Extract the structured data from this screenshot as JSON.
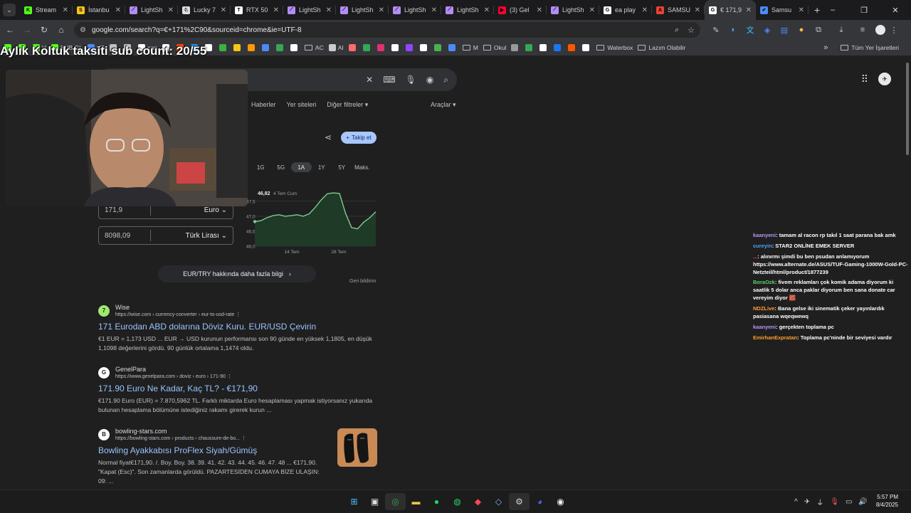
{
  "tabs": [
    {
      "label": "Stream",
      "color": "#53fc18",
      "glyph": "K"
    },
    {
      "label": "İstanbu",
      "color": "#f5c518",
      "glyph": "S"
    },
    {
      "label": "LightSh",
      "color": "#b38cf5",
      "glyph": "⟋"
    },
    {
      "label": "Lucky 7",
      "color": "#dddddd",
      "glyph": "♘"
    },
    {
      "label": "RTX 50",
      "color": "#ffffff",
      "glyph": "T"
    },
    {
      "label": "LightSh",
      "color": "#b38cf5",
      "glyph": "⟋"
    },
    {
      "label": "LightSh",
      "color": "#b38cf5",
      "glyph": "⟋"
    },
    {
      "label": "LightSh",
      "color": "#b38cf5",
      "glyph": "⟋"
    },
    {
      "label": "LightSh",
      "color": "#b38cf5",
      "glyph": "⟋"
    },
    {
      "label": "(3) Gel",
      "color": "#ff0033",
      "glyph": "▶"
    },
    {
      "label": "LightSh",
      "color": "#b38cf5",
      "glyph": "⟋"
    },
    {
      "label": "ea play",
      "color": "#ffffff",
      "glyph": "G"
    },
    {
      "label": "SAMSU",
      "color": "#ea4335",
      "glyph": "A"
    },
    {
      "label": "€ 171,9",
      "color": "#ffffff",
      "glyph": "G",
      "active": true
    },
    {
      "label": "Samsu",
      "color": "#4c8bf5",
      "glyph": "✔"
    }
  ],
  "toolbar": {
    "url": "google.com/search?q=€+171%2C90&sourceid=chrome&ie=UTF-8"
  },
  "bookmarks": [
    {
      "label": "",
      "color": "#53fc18"
    },
    {
      "label": "",
      "color": "#53fc18"
    },
    {
      "label": "V",
      "color": "#53fc18"
    },
    {
      "label": "SUB.GL",
      "color": "#53fc18"
    },
    {
      "label": "VS",
      "color": "#4c8bf5"
    },
    {
      "label": "",
      "color": "#c0c0c0"
    },
    {
      "label": "",
      "color": "#c0c0c0"
    },
    {
      "label": "can",
      "color": "#ffffff"
    },
    {
      "label": "",
      "color": "#ffffff"
    },
    {
      "label": "",
      "color": "#ff4500"
    },
    {
      "label": "",
      "color": "#1d9bf0"
    },
    {
      "label": "",
      "color": "#ffffff"
    },
    {
      "label": "",
      "color": "#3cb043"
    },
    {
      "label": "",
      "color": "#f5c518"
    },
    {
      "label": "",
      "color": "#ff9800"
    },
    {
      "label": "",
      "color": "#4c8bf5"
    },
    {
      "label": "",
      "color": "#34a853"
    },
    {
      "label": "",
      "color": "#ffffff"
    },
    {
      "label": "AC",
      "folder": true
    },
    {
      "label": "AI",
      "color": "#cccccc"
    },
    {
      "label": "",
      "color": "#ff6b6b"
    },
    {
      "label": "",
      "color": "#34a853"
    },
    {
      "label": "",
      "color": "#e1306c"
    },
    {
      "label": "",
      "color": "#ffffff"
    },
    {
      "label": "",
      "color": "#9146ff"
    },
    {
      "label": "",
      "color": "#ffffff"
    },
    {
      "label": "",
      "color": "#4caf50"
    },
    {
      "label": "",
      "color": "#4c8bf5"
    },
    {
      "label": "M",
      "folder": true
    },
    {
      "label": "Okul",
      "folder": true
    },
    {
      "label": "",
      "color": "#999999"
    },
    {
      "label": "",
      "color": "#34a853"
    },
    {
      "label": "",
      "color": "#ffffff"
    },
    {
      "label": "",
      "color": "#1877f2"
    },
    {
      "label": "",
      "color": "#ff5500"
    },
    {
      "label": "",
      "color": "#ffffff"
    },
    {
      "label": "Waterbox",
      "folder": true
    },
    {
      "label": "Lazım Olabilir",
      "folder": true
    }
  ],
  "bookmarks_more": "»",
  "bookmarks_all": "Tüm Yer İşaretleri",
  "overlay": {
    "sub_count": "Aylık Koltuk taksiti sub count: 20/55"
  },
  "search": {
    "filters": [
      "Haberler",
      "Yer siteleri",
      "Diğer filtreler ▾"
    ],
    "tools": "Araçlar ▾",
    "follow_label": "Takip et",
    "follow_plus": "+"
  },
  "ranges": {
    "items": [
      "1G",
      "5G",
      "1A",
      "1Y",
      "5Y",
      "Maks."
    ],
    "selected": "1A"
  },
  "chart_data": {
    "type": "area",
    "y_ticks": [
      "47,5",
      "47,0",
      "46,5",
      "46,0"
    ],
    "x_ticks": [
      "14 Tem",
      "28 Tem"
    ],
    "tooltip_value": "46,82",
    "tooltip_date": "4 Tem Cum",
    "ylim": [
      46.0,
      47.9
    ],
    "values": [
      46.82,
      46.85,
      46.95,
      47.02,
      47.05,
      47.0,
      47.02,
      47.05,
      47.0,
      47.08,
      47.3,
      47.55,
      47.75,
      47.78,
      47.76,
      47.1,
      46.62,
      46.58,
      46.8,
      46.95,
      47.15
    ]
  },
  "converter": {
    "amount": "171,9",
    "from_currency": "Euro",
    "result": "8098,09",
    "to_currency": "Türk Lirası"
  },
  "more_link": "EUR/TRY hakkında daha fazla bilgi",
  "feedback": "Geri bildirim",
  "results": [
    {
      "site": "Wise",
      "url": "https://wise.com › currency-converter › eur-to-usd-rate",
      "title": "171 Eurodan ABD dolarına Döviz Kuru. EUR/USD Çevirin",
      "snippet": "€1 EUR = 1,173 USD ... EUR → USD kurunun performansı son 90 günde en yüksek 1,1805, en düşük 1,1098 değerlerini gördü. 90 günlük ortalama 1,1474 oldu.",
      "logo_color": "#9fe870",
      "logo_glyph": "7"
    },
    {
      "site": "GenelPara",
      "url": "https://www.genelpara.com › doviz › euro › 171-90",
      "title": "171.90 Euro Ne Kadar, Kaç TL? - €171,90",
      "snippet": "€171.90 Euro (EUR) = 7.870,5962 TL. Farklı miktarda Euro hesaplaması yapmak istiyorsanız yukarıda bulunan hesaplama bölümüne istediğiniz rakamı girerek kurun ...",
      "logo_color": "#ffffff",
      "logo_glyph": "G"
    },
    {
      "site": "bowling-stars.com",
      "url": "https://bowling-stars.com › products › chaussure-de-bo...",
      "title": "Bowling Ayakkabısı ProFlex Siyah/Gümüş",
      "snippet": "Normal fiyat€171,90. /. Boy. Boy. 38. 39. 41. 42. 43. 44. 45. 46. 47. 48 ... €171,90. \"Kapat (Esc)\". Son zamanlarda görüldü. PAZARTESİDEN CUMAYA BİZE ULAŞIN: 09: ...",
      "logo_color": "#ffffff",
      "logo_glyph": "B"
    }
  ],
  "chat": [
    {
      "user": "kaanyeni",
      "color": "#b794f6",
      "text": "tamam al racon rp takıl 1 saat parana bak amk"
    },
    {
      "user": "cureyin",
      "color": "#4da3ff",
      "text": "STAR2 ONLİNE EMEK SERVER"
    },
    {
      "user": "...",
      "color": "#ff4f6d",
      "text": "alınırmı şimdi bu ben psudan anlamıyorum https://www.alternate.de/ASUS/TUF-Gaming-1000W-Gold-PC-Netzteil/html/product/1877239"
    },
    {
      "user": "BoraOzk",
      "color": "#5fd068",
      "text": "fivem reklamları çok komik adama diyorum ki saatlik 5 dolar anca paklar diyorum ben sana donate car vereyim diyor 🧱"
    },
    {
      "user": "NDZLive",
      "color": "#ff9d2f",
      "text": "Bana gelse iki sinematik çeker yayınlardık pasiasana wqeqwewq"
    },
    {
      "user": "kaanyeni",
      "color": "#b794f6",
      "text": "gerçekten toplama pc"
    },
    {
      "user": "EmirhanExpratan",
      "color": "#ff9d2f",
      "text": "Toplama pc'ninde bir seviyesi vardır"
    }
  ],
  "taskbar": {
    "time": "5:57 PM",
    "date": "8/4/2025"
  }
}
